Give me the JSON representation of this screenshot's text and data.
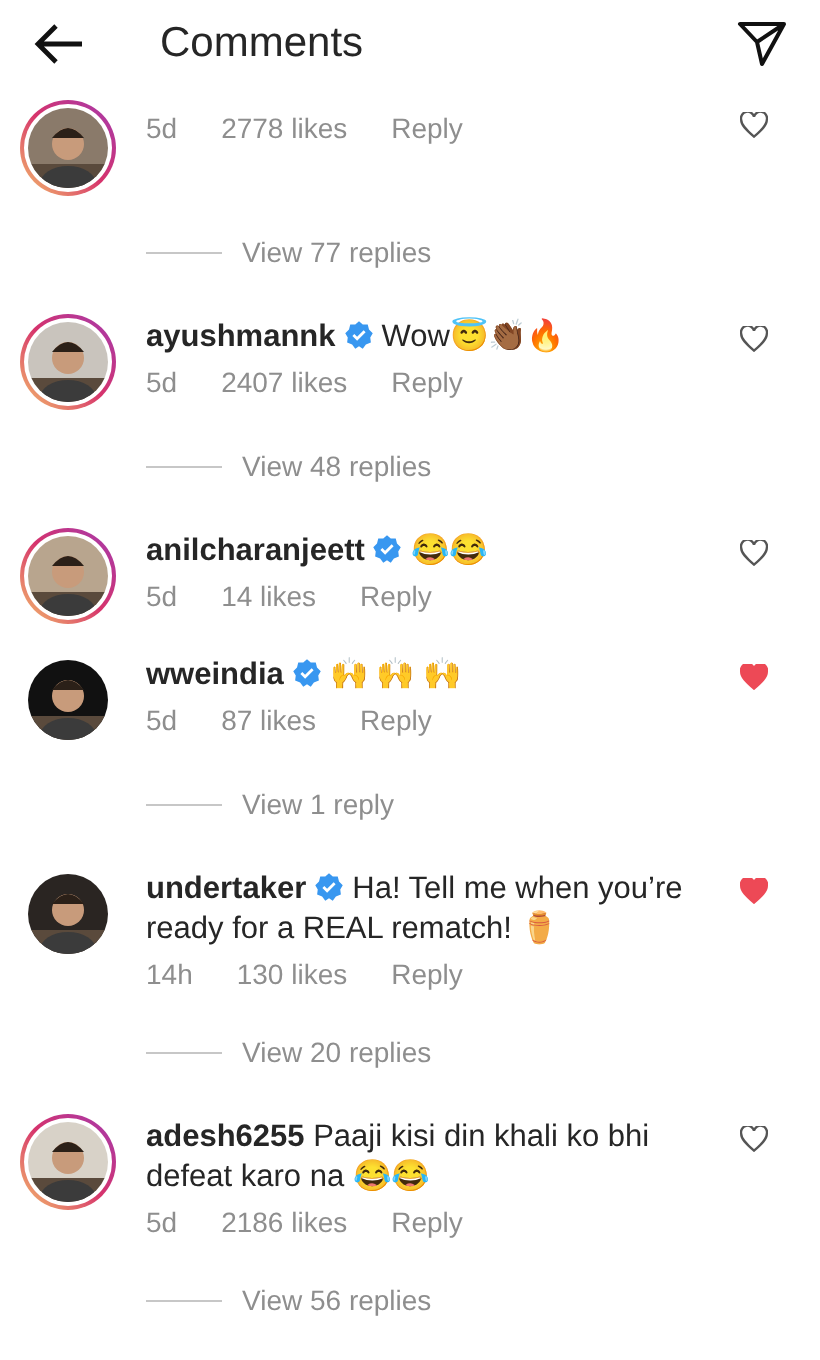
{
  "header": {
    "title": "Comments"
  },
  "comments": [
    {
      "story_ring": true,
      "time": "5d",
      "likes": "2778 likes",
      "reply": "Reply",
      "liked": false,
      "view_replies": "View 77 replies"
    },
    {
      "username": "ayushmannk",
      "verified": true,
      "text": "Wow😇👏🏾🔥",
      "story_ring": true,
      "time": "5d",
      "likes": "2407 likes",
      "reply": "Reply",
      "liked": false,
      "view_replies": "View 48 replies"
    },
    {
      "username": "anilcharanjeett",
      "verified": true,
      "text": "😂😂",
      "story_ring": true,
      "time": "5d",
      "likes": "14 likes",
      "reply": "Reply",
      "liked": false
    },
    {
      "username": "wweindia",
      "verified": true,
      "text": "🙌 🙌 🙌",
      "story_ring": false,
      "time": "5d",
      "likes": "87 likes",
      "reply": "Reply",
      "liked": true,
      "view_replies": "View 1 reply"
    },
    {
      "username": "undertaker",
      "verified": true,
      "text": "Ha! Tell me when you’re ready for a REAL rematch! ⚱️",
      "story_ring": false,
      "time": "14h",
      "likes": "130 likes",
      "reply": "Reply",
      "liked": true,
      "view_replies": "View 20 replies"
    },
    {
      "username": "adesh6255",
      "verified": false,
      "text": "Paaji kisi din khali ko bhi defeat karo na 😂😂",
      "story_ring": true,
      "time": "5d",
      "likes": "2186 likes",
      "reply": "Reply",
      "liked": false,
      "view_replies": "View 56 replies"
    }
  ]
}
